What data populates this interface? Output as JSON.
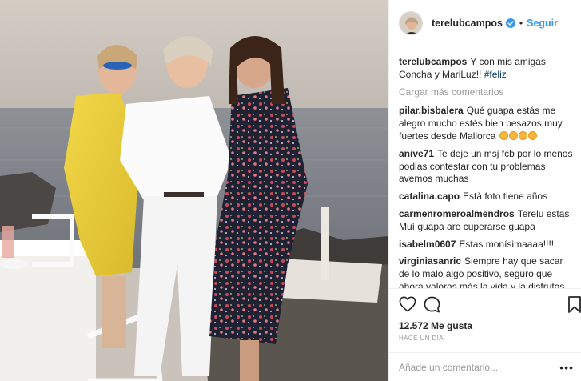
{
  "post": {
    "username": "terelubcampos",
    "follow_label": "Seguir",
    "separator": "•",
    "caption_user": "terelubcampos",
    "caption_text": "Y con mis amigas Concha y MariLuz!! ",
    "caption_hashtag": "#feliz",
    "load_more": "Cargar más comentarios",
    "likes": "12.572 Me gusta",
    "timestamp": "HACE UN DÍA",
    "add_comment_placeholder": "Añade un comentario...",
    "options": "•••"
  },
  "comments": [
    {
      "user": "pilar.bisbalera",
      "text": "Qué guapa estás me alegro mucho estés bien besazos muy fuertes desde Mallorca",
      "emojis": 4
    },
    {
      "user": "anive71",
      "text": "Te deje un msj fcb por lo menos podias contestar con tu problemas avemos muchas",
      "emojis": 0
    },
    {
      "user": "catalina.capo",
      "text": "Està foto tiene años",
      "emojis": 0
    },
    {
      "user": "carmenromeroalmendros",
      "text": "Terelu estas Muí guapa are cuperarse guapa",
      "emojis": 0
    },
    {
      "user": "isabelm0607",
      "text": "Estas monísimaaaa!!!!",
      "emojis": 0
    },
    {
      "user": "virginiasanric",
      "text": "Siempre hay que sacar de lo malo algo positivo, seguro que ahora valoras más la vida y la disfrutas con la gente que quieres y sin pensar en complejos",
      "emojis": 1
    }
  ],
  "icons": {
    "verified": "verified-badge-icon",
    "like": "heart-icon",
    "comment": "speech-bubble-icon",
    "save": "bookmark-icon"
  },
  "colors": {
    "link": "#3897f0",
    "muted": "#999999",
    "verified": "#3897f0",
    "hashtag": "#003569"
  }
}
